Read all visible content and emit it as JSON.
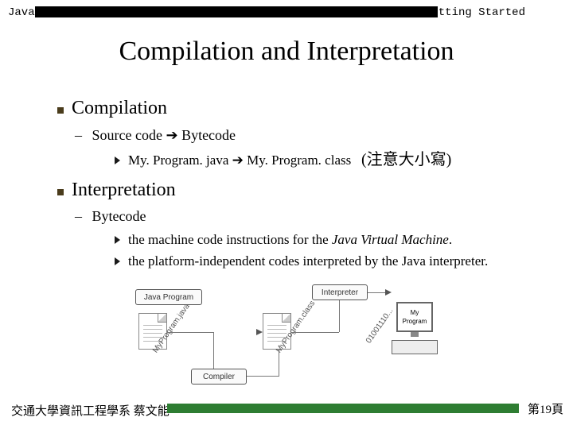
{
  "header": {
    "left": "Java",
    "right": "Getting Started"
  },
  "title": "Compilation and Interpretation",
  "sections": [
    {
      "heading": "Compilation",
      "sub": "Source code → Bytecode",
      "items": [
        {
          "text": "My. Program. java → My. Program. class",
          "annot": "(注意大小寫)"
        }
      ]
    },
    {
      "heading": "Interpretation",
      "sub": "Bytecode",
      "items": [
        {
          "text_a": "the machine code instructions for the ",
          "em": "Java Virtual Machine",
          "text_b": "."
        },
        {
          "text": "the platform-independent codes interpreted by the Java interpreter."
        }
      ]
    }
  ],
  "diagram": {
    "javaProgram": "Java Program",
    "compiler": "Compiler",
    "interpreter": "Interpreter",
    "file1": "MyProgram.java",
    "file2": "MyProgram.class",
    "file3": "01001110...",
    "screen": "My Program"
  },
  "footer": {
    "left": "交通大學資訊工程學系 蔡文能",
    "right": "第19頁"
  }
}
